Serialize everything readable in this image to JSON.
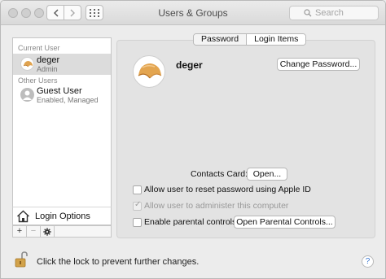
{
  "window": {
    "title": "Users & Groups",
    "search_placeholder": "Search"
  },
  "sidebar": {
    "current_user_label": "Current User",
    "other_users_label": "Other Users",
    "users": [
      {
        "name": "deger",
        "role": "Admin"
      },
      {
        "name": "Guest User",
        "role": "Enabled, Managed"
      }
    ],
    "login_options_label": "Login Options",
    "toolbar": {
      "add": "+",
      "remove": "−"
    }
  },
  "tabs": [
    {
      "label": "Password",
      "active": true
    },
    {
      "label": "Login Items",
      "active": false
    }
  ],
  "account": {
    "name": "deger",
    "change_password_label": "Change Password...",
    "contacts_card_label": "Contacts Card:",
    "open_label": "Open...",
    "options": [
      {
        "label": "Allow user to reset password using Apple ID",
        "checked": false,
        "enabled": true
      },
      {
        "label": "Allow user to administer this computer",
        "checked": true,
        "enabled": false
      },
      {
        "label": "Enable parental controls",
        "checked": false,
        "enabled": true
      }
    ],
    "open_parental_controls_label": "Open Parental Controls..."
  },
  "footer": {
    "lock_text": "Click the lock to prevent further changes.",
    "help": "?"
  }
}
